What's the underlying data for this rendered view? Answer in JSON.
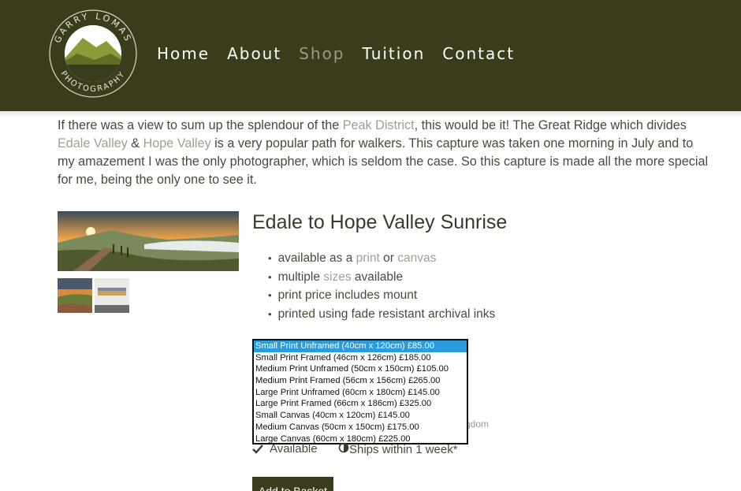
{
  "logo": {
    "text_top": "GARRY LOMAS",
    "text_bottom": "PHOTOGRAPHY"
  },
  "nav": {
    "items": [
      "Home",
      "About",
      "Shop",
      "Tuition",
      "Contact"
    ],
    "active": "Shop"
  },
  "intro": {
    "p1": "If there was a view to sum up the splendour of the ",
    "l1": "Peak District",
    "p2": ", this would be it! The Great Ridge which divides ",
    "l2": "Edale Valley",
    "p3": " & ",
    "l3": "Hope Valley",
    "p4": " is a very popular path for walkers. This capture was taken one morning in July and to my amazement I was the only photographer, which is seldom the case. So this capture is made all the more special for me, being the only one to see it."
  },
  "product": {
    "title": "Edale to Hope Valley Sunrise",
    "features": {
      "f1a": "available as a ",
      "f1_print": "print",
      "f1b": " or ",
      "f1_canvas": "canvas",
      "f2a": "multiple ",
      "f2_sizes": "sizes",
      "f2b": " available",
      "f3": "print price includes mount",
      "f4": "printed using fade resistant archival inks"
    },
    "options": [
      "Small Print Unframed (40cm x 120cm) £85.00",
      "Small Print Framed (46cm x 126cm) £185.00",
      "Medium Print Unframed (50cm x 150cm) £105.00",
      "Medium Print Framed (56cm x 156cm) £265.00",
      "Large Print Unframed (60cm x 180cm) £145.00",
      "Large Print Framed (66cm x 186cm) £325.00",
      "Small Canvas (40cm x 120cm) £145.00",
      "Medium Canvas (50cm x 150cm) £175.00",
      "Large Canvas (60cm x 180cm) £225.00"
    ],
    "selected_index": 0,
    "partial_text_behind": "gdom",
    "availability": "Available",
    "shipping": "Ships within 1 week*",
    "basket_label": "Add to Basket"
  },
  "colors": {
    "header_bg": "#3b3c1c",
    "link_muted": "#a0a090",
    "select_highlight": "#2a9bdc"
  },
  "icons": [
    "check-icon",
    "half-circle-icon"
  ]
}
